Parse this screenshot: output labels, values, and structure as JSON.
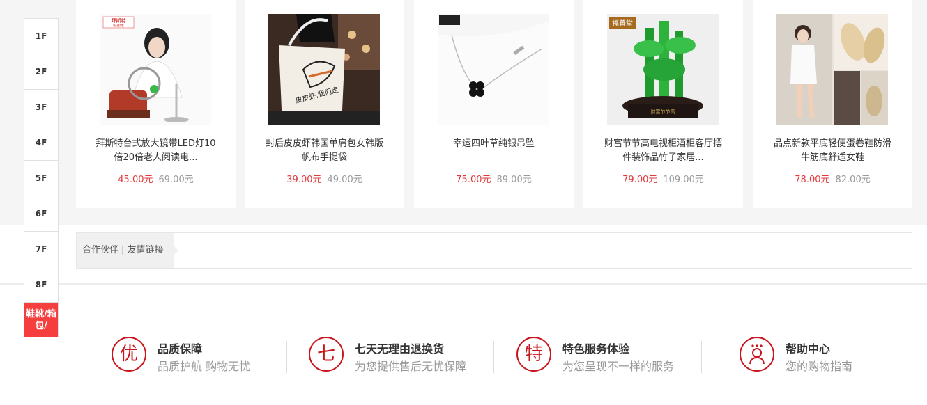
{
  "products": [
    {
      "title": "拜斯特台式放大镜带LED灯10倍20倍老人阅读电...",
      "price": "45.00元",
      "old_price": "69.00元",
      "brand_tag": "拜斯特",
      "brand_sub": "BAISITE"
    },
    {
      "title": "封后皮皮虾韩国单肩包女韩版帆布手提袋",
      "price": "39.00元",
      "old_price": "49.00元",
      "bag_text": "皮皮虾,我们走"
    },
    {
      "title": "幸运四叶草纯银吊坠",
      "price": "75.00元",
      "old_price": "89.00元"
    },
    {
      "title": "财富节节高电视柜酒柜客厅摆件装饰品竹子家居...",
      "price": "79.00元",
      "old_price": "109.00元",
      "brand_tag": "福善堂",
      "base_text": "财富节节高"
    },
    {
      "title": "品点新款平底轻便蛋卷鞋防滑牛筋底舒适女鞋",
      "price": "78.00元",
      "old_price": "82.00元"
    }
  ],
  "partner": {
    "label": "合作伙伴 | 友情链接"
  },
  "floors": [
    "1F",
    "2F",
    "3F",
    "4F",
    "5F",
    "6F",
    "7F",
    "8F"
  ],
  "active_floor": "鞋靴/箱包/",
  "services": [
    {
      "icon_char": "优",
      "icon": "quality-icon",
      "title": "品质保障",
      "sub": "品质护航 购物无忧"
    },
    {
      "icon_char": "七",
      "icon": "seven-day-icon",
      "title": "七天无理由退换货",
      "sub": "为您提供售后无忧保障"
    },
    {
      "icon_char": "特",
      "icon": "special-icon",
      "title": "特色服务体验",
      "sub": "为您呈现不一样的服务"
    },
    {
      "icon_char": "",
      "icon": "help-center-icon",
      "title": "帮助中心",
      "sub": "您的购物指南"
    }
  ],
  "colors": {
    "accent": "#e4393c",
    "brand_red": "#c9151e",
    "floor_active": "#f53f3f"
  }
}
